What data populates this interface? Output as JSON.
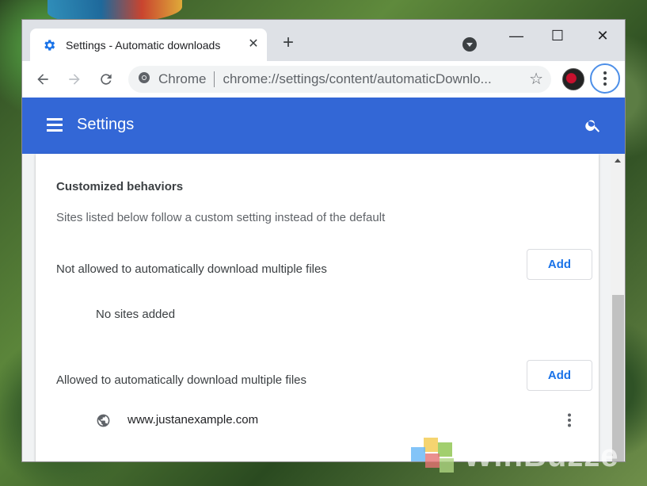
{
  "browser": {
    "tab_title": "Settings - Automatic downloads",
    "tab_close_glyph": "✕",
    "newtab_glyph": "+",
    "window_controls": {
      "minimize": "—",
      "maximize": "☐",
      "close": "✕"
    },
    "omnibox": {
      "site_name": "Chrome",
      "url": "chrome://settings/content/automaticDownlo..."
    }
  },
  "appbar": {
    "title": "Settings",
    "color": "#3367d6"
  },
  "content": {
    "heading": "Customized behaviors",
    "subtext": "Sites listed below follow a custom setting instead of the default",
    "blocked": {
      "label": "Not allowed to automatically download multiple files",
      "add_label": "Add",
      "empty_text": "No sites added"
    },
    "allowed": {
      "label": "Allowed to automatically download multiple files",
      "add_label": "Add",
      "sites": [
        {
          "url": "www.justanexample.com"
        }
      ]
    }
  },
  "watermark": {
    "text": "WinBuzze"
  },
  "icons": {
    "tab": "gear-icon",
    "back": "back-arrow-icon",
    "forward": "forward-arrow-icon",
    "reload": "reload-icon",
    "site_info": "chrome-logo-icon",
    "bookmark": "star-icon",
    "menu": "kebab-menu-icon",
    "hamburger": "hamburger-icon",
    "search": "search-icon",
    "site": "globe-icon",
    "site_more": "more-vert-icon"
  },
  "colors": {
    "accent": "#1a73e8",
    "focus_ring": "#4d8fe8"
  }
}
